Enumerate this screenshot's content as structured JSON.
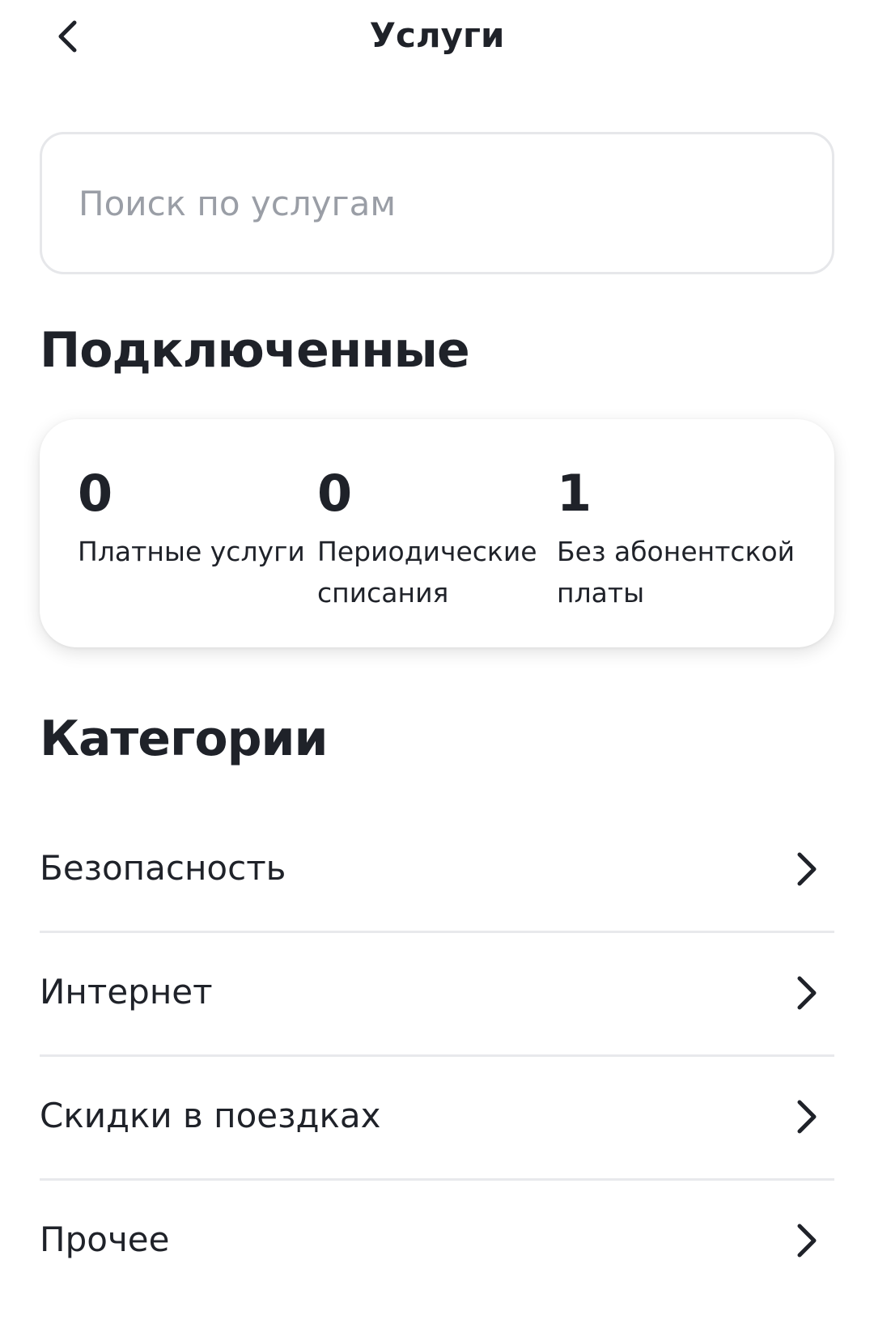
{
  "header": {
    "title": "Услуги",
    "back_icon": "chevron-left-icon"
  },
  "search": {
    "placeholder": "Поиск по услугам",
    "value": ""
  },
  "connected": {
    "title": "Подключенные",
    "stats": [
      {
        "value": "0",
        "label": "Платные услуги"
      },
      {
        "value": "0",
        "label": "Периодические списания"
      },
      {
        "value": "1",
        "label": "Без абонентской платы"
      }
    ]
  },
  "categories": {
    "title": "Категории",
    "items": [
      {
        "label": "Безопасность",
        "icon": "chevron-right-icon"
      },
      {
        "label": "Интернет",
        "icon": "chevron-right-icon"
      },
      {
        "label": "Скидки в поездках",
        "icon": "chevron-right-icon"
      },
      {
        "label": "Прочее",
        "icon": "chevron-right-icon"
      }
    ]
  },
  "colors": {
    "text": "#1f2229",
    "placeholder": "#9a9ea6",
    "border": "#e6e7ea",
    "divider": "#e8e9ec",
    "background": "#ffffff"
  }
}
